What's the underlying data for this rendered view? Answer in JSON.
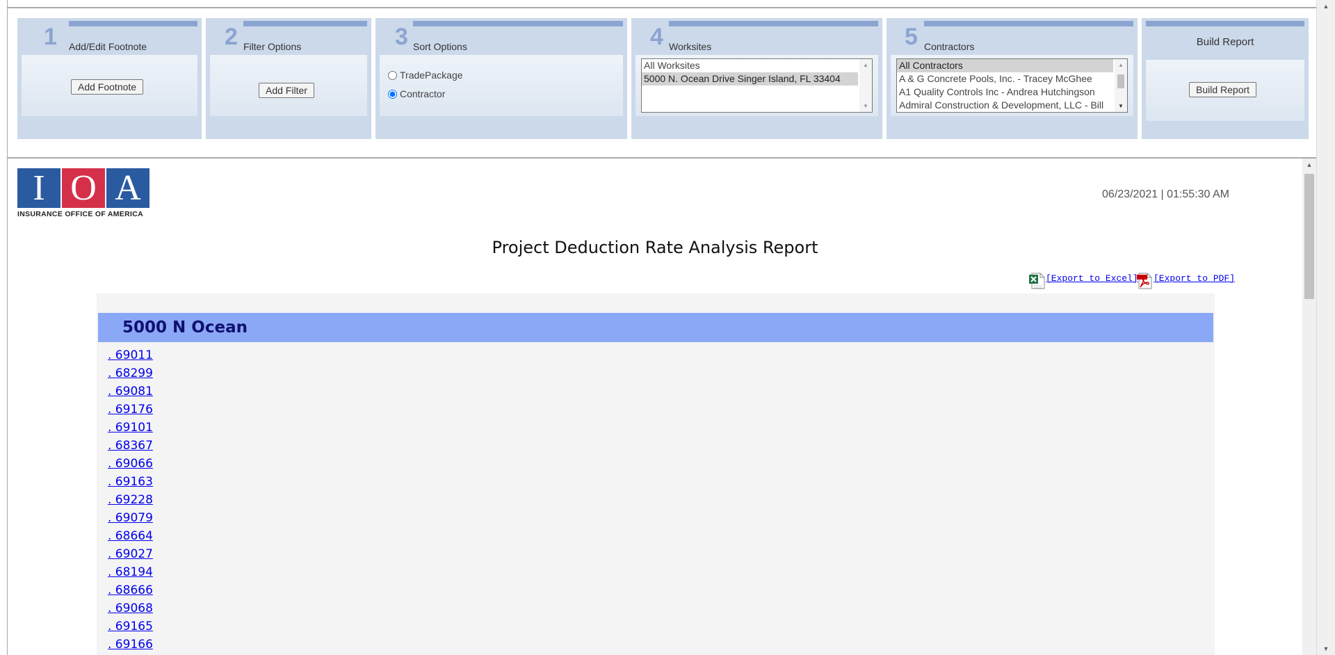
{
  "steps": [
    {
      "number": "1",
      "title": "Add/Edit Footnote",
      "button": "Add Footnote"
    },
    {
      "number": "2",
      "title": "Filter Options",
      "button": "Add Filter"
    },
    {
      "number": "3",
      "title": "Sort Options",
      "options": [
        "TradePackage",
        "Contractor"
      ],
      "selected": "Contractor"
    },
    {
      "number": "4",
      "title": "Worksites",
      "options": [
        "All Worksites",
        "5000 N. Ocean Drive Singer Island, FL 33404"
      ],
      "selected": "5000 N. Ocean Drive Singer Island, FL 33404"
    },
    {
      "number": "5",
      "title": "Contractors",
      "options": [
        "All Contractors",
        "A & G Concrete Pools, Inc. - Tracey McGhee",
        "A1 Quality Controls Inc - Andrea Hutchingson",
        "Admiral Construction & Development, LLC - Bill"
      ],
      "selected": "All Contractors"
    },
    {
      "title": "Build Report",
      "button": "Build Report"
    }
  ],
  "report": {
    "logo": {
      "letters": [
        "I",
        "O",
        "A"
      ],
      "tagline": "INSURANCE OFFICE OF AMERICA"
    },
    "timestamp": "06/23/2021 | 01:55:30 AM",
    "title": "Project Deduction Rate Analysis Report",
    "export_excel": "[Export to Excel]",
    "export_pdf": "[Export to PDF]",
    "site_name": "5000 N Ocean",
    "items": [
      ". 69011",
      ". 68299",
      ". 69081",
      ". 69176",
      ". 69101",
      ". 68367",
      ". 69066",
      ". 69163",
      ". 69228",
      ". 69079",
      ". 68664",
      ". 69027",
      ". 68194",
      ". 68666",
      ". 69068",
      ". 69165",
      ". 69166"
    ]
  },
  "colors": {
    "panel": "#cbd9ea",
    "accent": "#8ba4d1",
    "site_header": "#8ba8f7",
    "logo_blue": "#2a5aa0",
    "logo_red": "#d5304a"
  },
  "icons": [
    "excel-icon",
    "pdf-icon",
    "scroll-up-arrow",
    "scroll-down-arrow"
  ]
}
